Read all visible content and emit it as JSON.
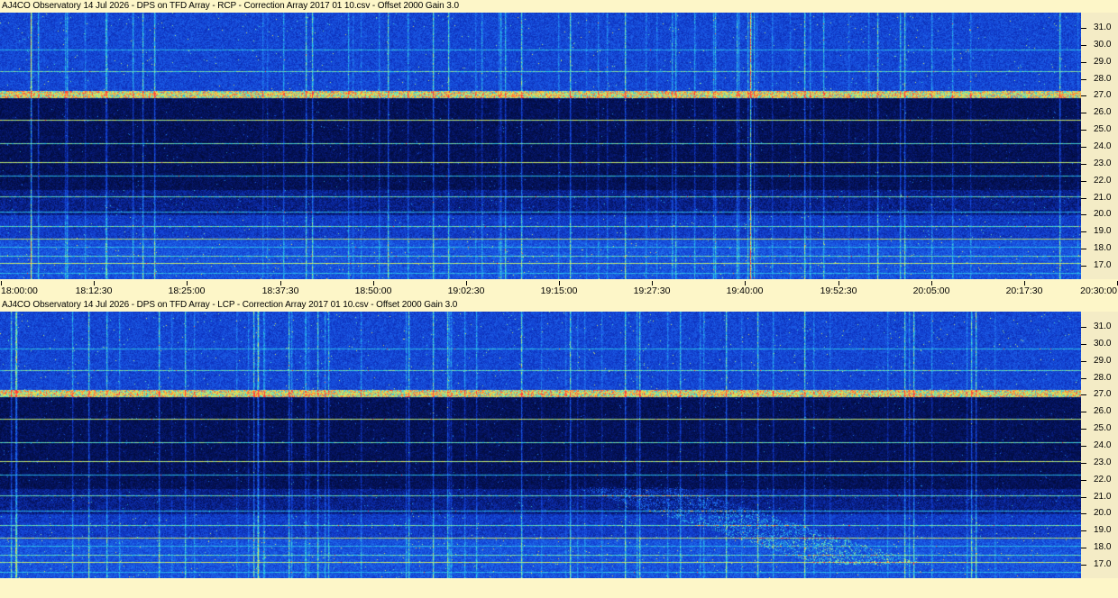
{
  "panels": [
    {
      "title": "AJ4CO Observatory 14 Jul 2026  -  DPS on TFD Array  -  RCP  -  Correction Array 2017 01 10.csv  -  Offset 2000  Gain 3.0",
      "polarization": "RCP"
    },
    {
      "title": "AJ4CO Observatory 14 Jul 2026  -  DPS on TFD Array  -  LCP  -  Correction Array 2017 01 10.csv  -  Offset 2000  Gain 3.0",
      "polarization": "LCP"
    }
  ],
  "chart_data": [
    {
      "type": "heatmap",
      "title": "AJ4CO Observatory 14 Jul 2026  -  DPS on TFD Array  -  RCP  -  Correction Array 2017 01 10.csv  -  Offset 2000  Gain 3.0",
      "x_tick_labels": [
        "18:00:00",
        "18:12:30",
        "18:25:00",
        "18:37:30",
        "18:50:00",
        "19:02:30",
        "19:15:00",
        "19:27:30",
        "19:40:00",
        "19:52:30",
        "20:05:00",
        "20:17:30",
        "20:30:00"
      ],
      "xlim": [
        "18:00:00",
        "20:30:00"
      ],
      "y_tick_labels": [
        "31.0",
        "30.0",
        "29.0",
        "28.0",
        "27.0",
        "26.0",
        "25.0",
        "24.0",
        "23.0",
        "22.0",
        "21.0",
        "20.0",
        "19.0",
        "18.0",
        "17.0"
      ],
      "y_ticks": [
        31,
        30,
        29,
        28,
        27,
        26,
        25,
        24,
        23,
        22,
        21,
        20,
        19,
        18,
        17
      ],
      "ylim": [
        16.2,
        31.9
      ],
      "colormap": [
        "#000a30",
        "#0a2aa0",
        "#1e5ae6",
        "#28c8e6",
        "#c8f078",
        "#ffd040",
        "#ff4040"
      ]
    },
    {
      "type": "heatmap",
      "title": "AJ4CO Observatory 14 Jul 2026  -  DPS on TFD Array  -  LCP  -  Correction Array 2017 01 10.csv  -  Offset 2000  Gain 3.0",
      "x_tick_labels": [],
      "xlim": [
        "18:00:00",
        "20:30:00"
      ],
      "y_tick_labels": [
        "31.0",
        "30.0",
        "29.0",
        "28.0",
        "27.0",
        "26.0",
        "25.0",
        "24.0",
        "23.0",
        "22.0",
        "21.0",
        "20.0",
        "19.0",
        "18.0",
        "17.0"
      ],
      "y_ticks": [
        31,
        30,
        29,
        28,
        27,
        26,
        25,
        24,
        23,
        22,
        21,
        20,
        19,
        18,
        17
      ],
      "ylim": [
        16.2,
        31.9
      ],
      "colormap": [
        "#000a30",
        "#0a2aa0",
        "#1e5ae6",
        "#28c8e6",
        "#c8f078",
        "#ffd040",
        "#ff4040"
      ]
    }
  ]
}
